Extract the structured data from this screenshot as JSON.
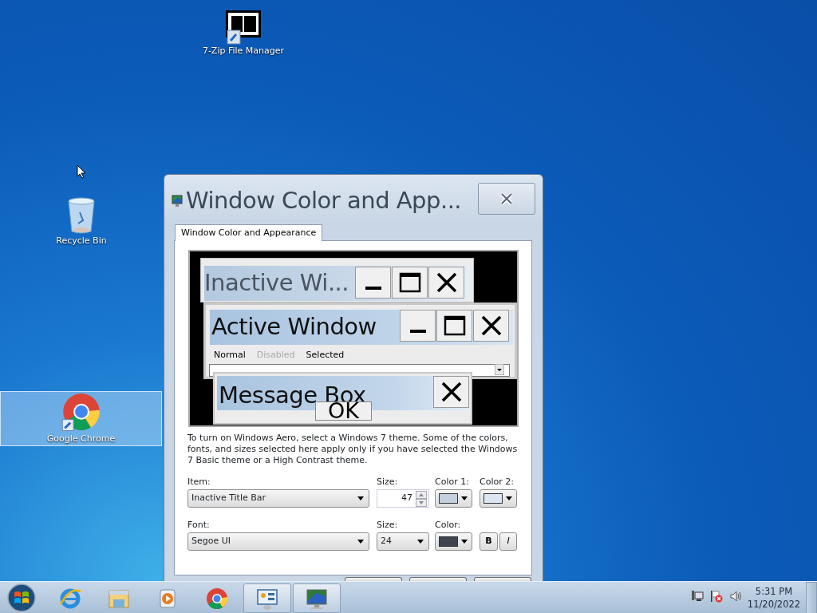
{
  "desktop_icons": [
    {
      "label": "7-Zip File Manager",
      "kind": "sevenzip",
      "selected": false
    },
    {
      "label": "Recycle Bin",
      "kind": "recycle",
      "selected": false
    },
    {
      "label": "Google Chrome",
      "kind": "chrome",
      "selected": true
    }
  ],
  "dialog": {
    "title": "Window Color and App...",
    "tabs": [
      {
        "label": "Window Color and Appearance",
        "selected": true
      }
    ],
    "preview": {
      "inactive_title": "Inactive Wi...",
      "active_title": "Active Window",
      "menu": [
        {
          "label": "Normal",
          "disabled": false
        },
        {
          "label": "Disabled",
          "disabled": true
        },
        {
          "label": "Selected",
          "disabled": false
        }
      ],
      "message_title": "Message Box",
      "ok": "OK"
    },
    "description": "To turn on Windows Aero, select a Windows 7 theme.  Some of the colors, fonts, and sizes selected here apply only if you have selected the Windows 7 Basic theme or a High Contrast theme.",
    "item": {
      "label": "Item:",
      "value": "Inactive Title Bar"
    },
    "item_size": {
      "label": "Size:",
      "value": "47"
    },
    "color1": {
      "label": "Color 1:",
      "color": "#c4d0de"
    },
    "color2": {
      "label": "Color 2:",
      "color": "#dde7f3"
    },
    "font": {
      "label": "Font:",
      "value": "Segoe UI"
    },
    "font_size": {
      "label": "Size:",
      "value": "24"
    },
    "font_color": {
      "label": "Color:",
      "color": "#3e4550"
    },
    "bold": "B",
    "italic": "I"
  },
  "taskbar": {
    "items": [
      {
        "kind": "ie",
        "open": false
      },
      {
        "kind": "explorer",
        "open": false
      },
      {
        "kind": "media",
        "open": false
      },
      {
        "kind": "chrome",
        "open": false
      },
      {
        "kind": "control",
        "open": true
      },
      {
        "kind": "display",
        "open": true
      }
    ],
    "clock": {
      "time": "5:31 PM",
      "date": "11/20/2022"
    }
  }
}
